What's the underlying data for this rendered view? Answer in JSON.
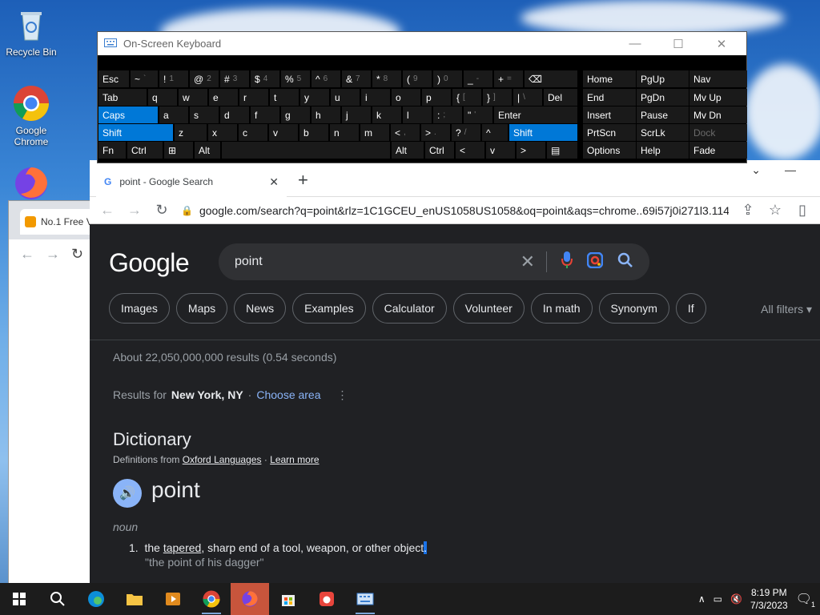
{
  "desktop": {
    "icons": [
      {
        "label": "Recycle Bin"
      },
      {
        "label": "Google Chrome"
      }
    ]
  },
  "back_window": {
    "tab_title": "No.1 Free V"
  },
  "osk": {
    "title": "On-Screen Keyboard",
    "rows": [
      [
        {
          "t": "Esc"
        },
        {
          "t": "~",
          "s": "`"
        },
        {
          "t": "!",
          "s": "1"
        },
        {
          "t": "@",
          "s": "2"
        },
        {
          "t": "#",
          "s": "3"
        },
        {
          "t": "$",
          "s": "4"
        },
        {
          "t": "%",
          "s": "5"
        },
        {
          "t": "^",
          "s": "6"
        },
        {
          "t": "&",
          "s": "7"
        },
        {
          "t": "*",
          "s": "8"
        },
        {
          "t": "(",
          "s": "9"
        },
        {
          "t": ")",
          "s": "0"
        },
        {
          "t": "_",
          "s": "-"
        },
        {
          "t": "+",
          "s": "="
        },
        {
          "t": "⌫"
        }
      ],
      [
        {
          "t": "Tab"
        },
        {
          "t": "q"
        },
        {
          "t": "w"
        },
        {
          "t": "e"
        },
        {
          "t": "r"
        },
        {
          "t": "t"
        },
        {
          "t": "y"
        },
        {
          "t": "u"
        },
        {
          "t": "i"
        },
        {
          "t": "o"
        },
        {
          "t": "p"
        },
        {
          "t": "{",
          "s": "["
        },
        {
          "t": "}",
          "s": "]"
        },
        {
          "t": "|",
          "s": "\\"
        },
        {
          "t": "Del"
        }
      ],
      [
        {
          "t": "Caps"
        },
        {
          "t": "a"
        },
        {
          "t": "s"
        },
        {
          "t": "d"
        },
        {
          "t": "f"
        },
        {
          "t": "g"
        },
        {
          "t": "h"
        },
        {
          "t": "j"
        },
        {
          "t": "k"
        },
        {
          "t": "l"
        },
        {
          "t": ":",
          "s": ";"
        },
        {
          "t": "\"",
          "s": "'"
        },
        {
          "t": "Enter"
        }
      ],
      [
        {
          "t": "Shift"
        },
        {
          "t": "z"
        },
        {
          "t": "x"
        },
        {
          "t": "c"
        },
        {
          "t": "v"
        },
        {
          "t": "b"
        },
        {
          "t": "n"
        },
        {
          "t": "m"
        },
        {
          "t": "<",
          "s": ","
        },
        {
          "t": ">",
          "s": "."
        },
        {
          "t": "?",
          "s": "/"
        },
        {
          "t": "^"
        },
        {
          "t": "Shift"
        }
      ],
      [
        {
          "t": "Fn"
        },
        {
          "t": "Ctrl"
        },
        {
          "t": "⊞"
        },
        {
          "t": "Alt"
        },
        {
          "t": ""
        },
        {
          "t": "Alt"
        },
        {
          "t": "Ctrl"
        },
        {
          "t": "<"
        },
        {
          "t": "v"
        },
        {
          "t": ">"
        },
        {
          "t": "▤"
        }
      ]
    ],
    "nav": [
      [
        "Home",
        "PgUp",
        "Nav"
      ],
      [
        "End",
        "PgDn",
        "Mv Up"
      ],
      [
        "Insert",
        "Pause",
        "Mv Dn"
      ],
      [
        "PrtScn",
        "ScrLk",
        "Dock"
      ],
      [
        "Options",
        "Help",
        "Fade"
      ]
    ]
  },
  "chrome": {
    "tab_title": "point - Google Search",
    "url": "google.com/search?q=point&rlz=1C1GCEU_enUS1058US1058&oq=point&aqs=chrome..69i57j0i271l3.114..."
  },
  "google": {
    "logo": "Google",
    "query": "point",
    "chips": [
      "Images",
      "Maps",
      "News",
      "Examples",
      "Calculator",
      "Volunteer",
      "In math",
      "Synonym",
      "If"
    ],
    "all_filters": "All filters",
    "stats": "About 22,050,000,000 results (0.54 seconds)",
    "results_for": "Results for",
    "location": "New York, NY",
    "choose_area": "Choose area",
    "dictionary": "Dictionary",
    "defs_from": "Definitions from",
    "oxford": "Oxford Languages",
    "learn_more": "Learn more",
    "headword": "point",
    "pos": "noun",
    "def_num": "1.",
    "def_a": "the",
    "def_tapered": "tapered",
    "def_b": ", sharp end of a tool, weapon, or other object",
    "def_end": ".",
    "example": "\"the point of his dagger\""
  },
  "taskbar": {
    "time": "8:19 PM",
    "date": "7/3/2023",
    "notif_count": "1"
  }
}
